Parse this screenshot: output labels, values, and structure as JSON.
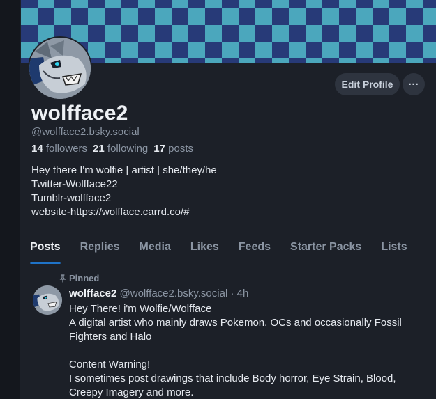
{
  "profile": {
    "display_name": "wolfface2",
    "handle": "@wolfface2.bsky.social",
    "followers_count": "14",
    "followers_label": "followers",
    "following_count": "21",
    "following_label": "following",
    "posts_count": "17",
    "posts_label": "posts",
    "bio": [
      "Hey there I'm wolfie | artist | she/they/he",
      "Twitter-Wolfface22",
      "Tumblr-wolfface2",
      "website-https://wolfface.carrd.co/#"
    ],
    "edit_button": "Edit Profile",
    "more_button": "···"
  },
  "tabs": [
    {
      "label": "Posts",
      "active": true
    },
    {
      "label": "Replies",
      "active": false
    },
    {
      "label": "Media",
      "active": false
    },
    {
      "label": "Likes",
      "active": false
    },
    {
      "label": "Feeds",
      "active": false
    },
    {
      "label": "Starter Packs",
      "active": false
    },
    {
      "label": "Lists",
      "active": false
    }
  ],
  "post": {
    "pinned_label": "Pinned",
    "author": "wolfface2",
    "handle": "@wolfface2.bsky.social",
    "separator": "·",
    "time": "4h",
    "lines": [
      "Hey There! i'm Wolfie/Wolfface",
      "A digital artist who mainly draws Pokemon, OCs and occasionally Fossil Fighters and Halo",
      "",
      "Content Warning!",
      "I sometimes post drawings that include Body horror, Eye Strain, Blood, Creepy Imagery and more."
    ]
  },
  "colors": {
    "background": "#1c2028",
    "banner_light": "#4ba7bd",
    "banner_dark": "#273a78",
    "accent": "#1f73c8",
    "muted_text": "#8b95a3"
  },
  "icons": {
    "pin": "pin-icon",
    "more": "ellipsis-icon"
  }
}
